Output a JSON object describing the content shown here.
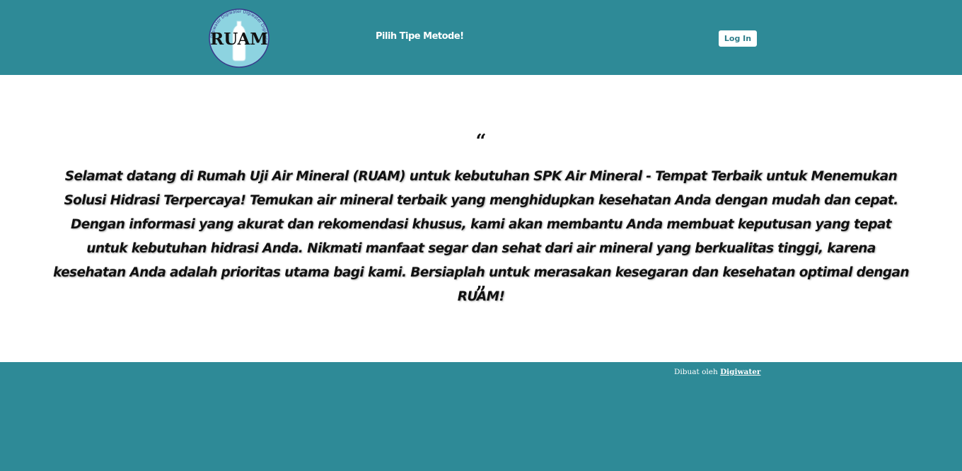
{
  "header": {
    "logo_text": "RUAM",
    "logo_ring_text": "Digiwater Digiwater Digiwater Digiwater",
    "nav_label": "Pilih Tipe Metode!",
    "login_label": "Log In"
  },
  "main": {
    "quote_open": "“",
    "quote_text": "Selamat datang di Rumah Uji Air Mineral (RUAM) untuk kebutuhan SPK Air Mineral - Tempat Terbaik untuk Menemukan Solusi Hidrasi Terpercaya! Temukan air mineral terbaik yang menghidupkan kesehatan Anda dengan mudah dan cepat. Dengan informasi yang akurat dan rekomendasi khusus, kami akan membantu Anda membuat keputusan yang tepat untuk kebutuhan hidrasi Anda. Nikmati manfaat segar dan sehat dari air mineral yang berkualitas tinggi, karena kesehatan Anda adalah prioritas utama bagi kami. Bersiaplah untuk merasakan kesegaran dan kesehatan optimal dengan RUAM!",
    "quote_close": "”"
  },
  "footer": {
    "credit_prefix": "Dibuat oleh ",
    "credit_link": "Digiwater"
  },
  "colors": {
    "header_bg": "#2e8a97",
    "footer_bg": "#2e8a97",
    "logo_bg": "#8dd3e0",
    "logo_ring": "#3a3a8c"
  }
}
